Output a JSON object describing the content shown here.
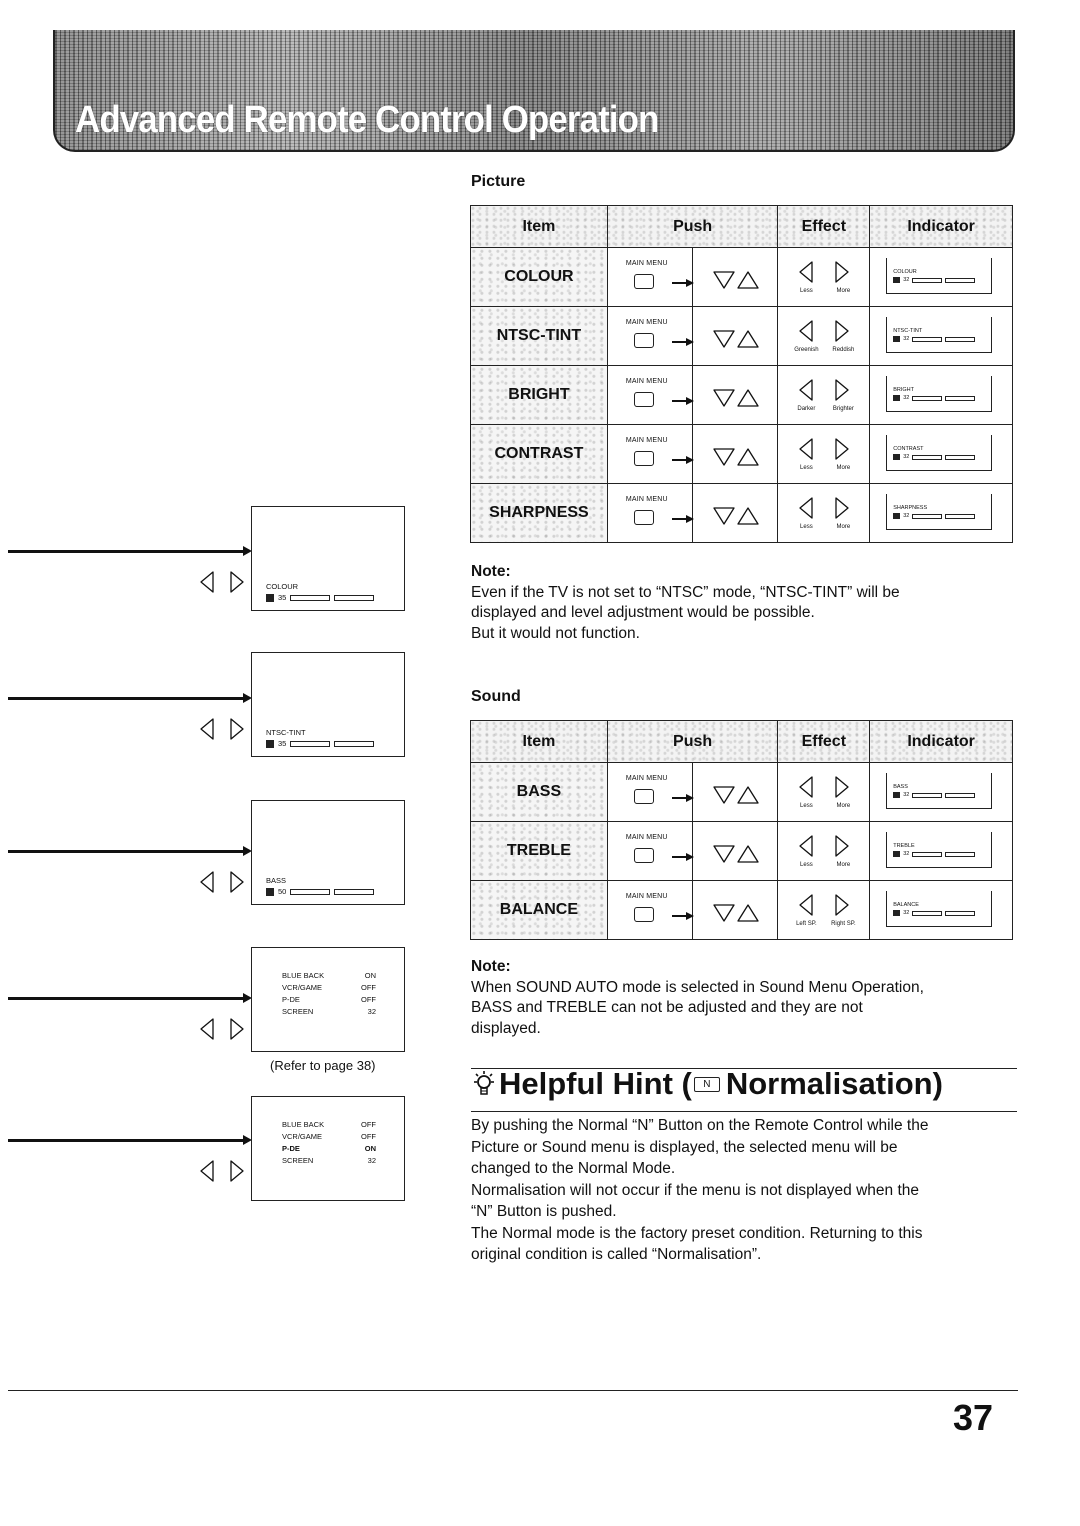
{
  "banner": {
    "title": "Advanced Remote Control Operation"
  },
  "picture": {
    "heading": "Picture",
    "headers": {
      "item": "Item",
      "push": "Push",
      "effect": "Effect",
      "indicator": "Indicator"
    },
    "rows": [
      {
        "item": "COLOUR",
        "push_label": "MAIN MENU",
        "effect_left": "Less",
        "effect_right": "More",
        "indicator_name": "COLOUR",
        "indicator_value": "32"
      },
      {
        "item": "NTSC-TINT",
        "push_label": "MAIN MENU",
        "effect_left": "Greenish",
        "effect_right": "Reddish",
        "indicator_name": "NTSC-TINT",
        "indicator_value": "32"
      },
      {
        "item": "BRIGHT",
        "push_label": "MAIN MENU",
        "effect_left": "Darker",
        "effect_right": "Brighter",
        "indicator_name": "BRIGHT",
        "indicator_value": "32"
      },
      {
        "item": "CONTRAST",
        "push_label": "MAIN MENU",
        "effect_left": "Less",
        "effect_right": "More",
        "indicator_name": "CONTRAST",
        "indicator_value": "32"
      },
      {
        "item": "SHARPNESS",
        "push_label": "MAIN MENU",
        "effect_left": "Less",
        "effect_right": "More",
        "indicator_name": "SHARPNESS",
        "indicator_value": "32"
      }
    ],
    "note_title": "Note:",
    "note_lines": [
      "Even if the TV is not set to “NTSC” mode, “NTSC-TINT” will be",
      "displayed and level adjustment would be possible.",
      "But it would not function."
    ]
  },
  "sound": {
    "heading": "Sound",
    "headers": {
      "item": "Item",
      "push": "Push",
      "effect": "Effect",
      "indicator": "Indicator"
    },
    "rows": [
      {
        "item": "BASS",
        "push_label": "MAIN MENU",
        "effect_left": "Less",
        "effect_right": "More",
        "indicator_name": "BASS",
        "indicator_value": "32"
      },
      {
        "item": "TREBLE",
        "push_label": "MAIN MENU",
        "effect_left": "Less",
        "effect_right": "More",
        "indicator_name": "TREBLE",
        "indicator_value": "32"
      },
      {
        "item": "BALANCE",
        "push_label": "MAIN MENU",
        "effect_left": "Left SP.",
        "effect_right": "Right SP.",
        "indicator_name": "BALANCE",
        "indicator_value": "32"
      }
    ],
    "note_title": "Note:",
    "note_lines": [
      "When SOUND AUTO mode is selected in Sound Menu Operation,",
      "BASS and TREBLE can not be adjusted and they are not",
      "displayed."
    ]
  },
  "screens": [
    {
      "name": "COLOUR",
      "value": "35"
    },
    {
      "name": "NTSC-TINT",
      "value": "35"
    },
    {
      "name": "BASS",
      "value": "50"
    }
  ],
  "setup_screens": [
    {
      "rows": [
        {
          "label": "BLUE BACK",
          "value": "ON"
        },
        {
          "label": "VCR/GAME",
          "value": "OFF"
        },
        {
          "label": "P-DE",
          "value": "OFF"
        },
        {
          "label": "SCREEN",
          "value": "32"
        }
      ]
    },
    {
      "rows": [
        {
          "label": "BLUE BACK",
          "value": "OFF"
        },
        {
          "label": "VCR/GAME",
          "value": "OFF"
        },
        {
          "label": "P-DE",
          "value": "ON"
        },
        {
          "label": "SCREEN",
          "value": "32"
        }
      ]
    }
  ],
  "refer_text": "(Refer to page 38)",
  "hint": {
    "title_prefix": "Helpful Hint (",
    "n_button": "N",
    "title_suffix": "Normalisation)",
    "body_lines": [
      "By pushing the Normal “N” Button on the Remote Control while the",
      "Picture or Sound menu is displayed, the selected menu will be",
      "changed to the Normal Mode.",
      "Normalisation will not occur if the menu is not displayed when the",
      "“N” Button is pushed.",
      "The Normal mode is the factory preset condition. Returning to this",
      "original condition is called “Normalisation”."
    ]
  },
  "page_number": "37"
}
